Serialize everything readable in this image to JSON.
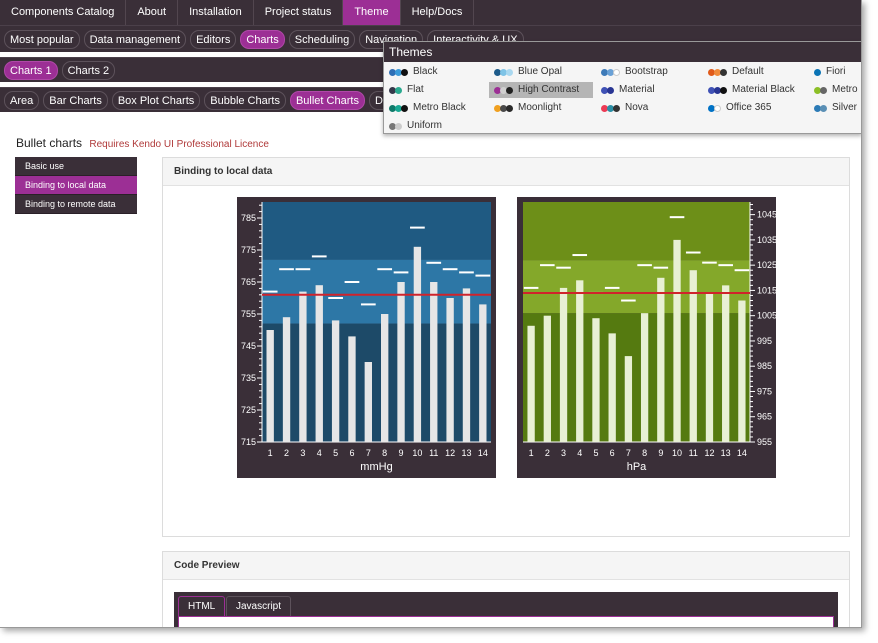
{
  "menu": [
    "Components Catalog",
    "About",
    "Installation",
    "Project status",
    "Theme",
    "Help/Docs"
  ],
  "menu_active": 4,
  "categories": [
    "Most popular",
    "Data management",
    "Editors",
    "Charts",
    "Scheduling",
    "Navigation",
    "Interactivity & UX"
  ],
  "categories_active": 3,
  "chart_groups": [
    "Charts 1",
    "Charts 2"
  ],
  "chart_groups_active": 0,
  "chart_types": [
    "Area",
    "Bar Charts",
    "Box Plot Charts",
    "Bubble Charts",
    "Bullet Charts",
    "Donut Ch"
  ],
  "chart_types_active": 4,
  "themes": {
    "title": "Themes",
    "items": [
      {
        "label": "Black",
        "dots": [
          "#2f6fb5",
          "#3a9ad9",
          "#111111"
        ]
      },
      {
        "label": "Blue Opal",
        "dots": [
          "#1d5b8a",
          "#7ec3e6",
          "#a9d8f0"
        ]
      },
      {
        "label": "Bootstrap",
        "dots": [
          "#3d7ab8",
          "#6aa1d6",
          "#ffffff"
        ]
      },
      {
        "label": "Default",
        "dots": [
          "#e05a1a",
          "#f08a3a",
          "#333333"
        ]
      },
      {
        "label": "Fiori",
        "dots": [
          "#0a74b5"
        ]
      },
      {
        "label": "Flat",
        "dots": [
          "#35384a",
          "#2aa98f"
        ]
      },
      {
        "label": "High Contrast",
        "dots": [
          "#9c2f95",
          "#d0d0d0",
          "#222222"
        ]
      },
      {
        "label": "Material",
        "dots": [
          "#3f51b5",
          "#283593"
        ]
      },
      {
        "label": "Material Black",
        "dots": [
          "#3f51b5",
          "#283593",
          "#111111"
        ]
      },
      {
        "label": "Metro",
        "dots": [
          "#8cbf26",
          "#666666"
        ]
      },
      {
        "label": "Metro Black",
        "dots": [
          "#0f7a6a",
          "#18a893",
          "#111111"
        ]
      },
      {
        "label": "Moonlight",
        "dots": [
          "#f0a020",
          "#4a4a4a",
          "#2a2a2a"
        ]
      },
      {
        "label": "Nova",
        "dots": [
          "#ec3b55",
          "#2b8fa6",
          "#333333"
        ]
      },
      {
        "label": "Office 365",
        "dots": [
          "#0072c6",
          "#ffffff"
        ]
      },
      {
        "label": "Silver",
        "dots": [
          "#2c7bb6",
          "#5a8fb5"
        ]
      },
      {
        "label": "Uniform",
        "dots": [
          "#777777",
          "#cccccc"
        ]
      }
    ],
    "selected": "High Contrast"
  },
  "page": {
    "title": "Bullet charts",
    "licence": "Requires Kendo UI Professional Licence"
  },
  "side_menu": [
    "Basic use",
    "Binding to local data",
    "Binding to remote data"
  ],
  "side_menu_active": 1,
  "panel_title": "Binding to local data",
  "code_preview": {
    "title": "Code Preview",
    "tabs": [
      "HTML",
      "Javascript"
    ],
    "active": 0
  },
  "colors": {
    "accent": "#9c2f95",
    "dark": "#3a2f38",
    "target": "#d0232b"
  },
  "chart_data": [
    {
      "type": "bullet",
      "xlabel": "mmHg",
      "categories": [
        1,
        2,
        3,
        4,
        5,
        6,
        7,
        8,
        9,
        10,
        11,
        12,
        13,
        14
      ],
      "ylim": [
        715,
        790
      ],
      "ticks": [
        715,
        725,
        735,
        745,
        755,
        765,
        775,
        785
      ],
      "values": [
        750,
        754,
        762,
        764,
        753,
        748,
        740,
        755,
        765,
        776,
        765,
        760,
        763,
        758
      ],
      "targets": [
        762,
        769,
        769,
        773,
        760,
        765,
        758,
        769,
        768,
        782,
        771,
        769,
        768,
        767
      ],
      "plot_bands": [
        {
          "from": 715,
          "to": 752
        },
        {
          "from": 752,
          "to": 772
        },
        {
          "from": 772,
          "to": 790
        }
      ],
      "reference": 761,
      "colors": {
        "bands": [
          "#1d4a68",
          "#2d77a6",
          "#1f5a82"
        ],
        "bar": "#e6e6e6",
        "bg": "#3a2f38"
      }
    },
    {
      "type": "bullet",
      "xlabel": "hPa",
      "categories": [
        1,
        2,
        3,
        4,
        5,
        6,
        7,
        8,
        9,
        10,
        11,
        12,
        13,
        14
      ],
      "ylim": [
        955,
        1050
      ],
      "ticks": [
        955,
        965,
        975,
        985,
        995,
        1005,
        1015,
        1025,
        1035,
        1045
      ],
      "values": [
        1001,
        1005,
        1016,
        1019,
        1004,
        998,
        989,
        1006,
        1020,
        1035,
        1023,
        1014,
        1017,
        1011
      ],
      "targets": [
        1016,
        1025,
        1024,
        1029,
        1014,
        1016,
        1011,
        1025,
        1024,
        1044,
        1030,
        1026,
        1025,
        1023
      ],
      "plot_bands": [
        {
          "from": 955,
          "to": 1006
        },
        {
          "from": 1006,
          "to": 1027
        },
        {
          "from": 1027,
          "to": 1050
        }
      ],
      "reference": 1014,
      "colors": {
        "bands": [
          "#557a10",
          "#84a82a",
          "#6d8f18"
        ],
        "bar": "#e8f0d4",
        "bg": "#3a2f38"
      }
    }
  ]
}
